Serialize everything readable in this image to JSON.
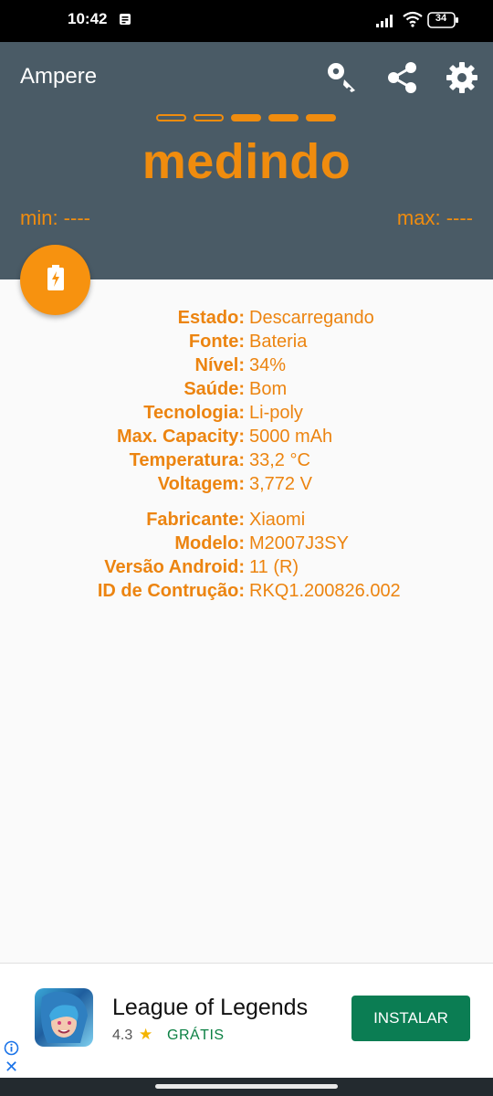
{
  "status_bar": {
    "time": "10:42",
    "battery": "34"
  },
  "app": {
    "title": "Ampere"
  },
  "toolbar": {
    "key_icon": "key-icon",
    "share_icon": "share-icon",
    "settings_icon": "gear-icon"
  },
  "meter": {
    "progress_segments": [
      false,
      false,
      true,
      true,
      true
    ],
    "status": "medindo",
    "min": "min: ----",
    "max": "max: ----"
  },
  "fab": {
    "icon": "battery-charging-icon"
  },
  "info_group_1": [
    {
      "label": "Estado:",
      "value": "Descarregando"
    },
    {
      "label": "Fonte:",
      "value": "Bateria"
    },
    {
      "label": "Nível:",
      "value": "34%"
    },
    {
      "label": "Saúde:",
      "value": "Bom"
    },
    {
      "label": "Tecnologia:",
      "value": "Li-poly"
    },
    {
      "label": "Max. Capacity:",
      "value": "5000 mAh"
    },
    {
      "label": "Temperatura:",
      "value": "33,2 °C"
    },
    {
      "label": "Voltagem:",
      "value": "3,772 V"
    }
  ],
  "info_group_2": [
    {
      "label": "Fabricante:",
      "value": "Xiaomi"
    },
    {
      "label": "Modelo:",
      "value": "M2007J3SY"
    },
    {
      "label": "Versão Android:",
      "value": "11 (R)"
    },
    {
      "label": "ID de Contrução:",
      "value": "RKQ1.200826.002"
    }
  ],
  "ad": {
    "title": "League of Legends",
    "rating": "4.3",
    "price": "GRÁTIS",
    "button": "INSTALAR"
  },
  "colors": {
    "accent": "#f08c0e",
    "header": "#4a5b66",
    "install": "#0b7d53"
  }
}
